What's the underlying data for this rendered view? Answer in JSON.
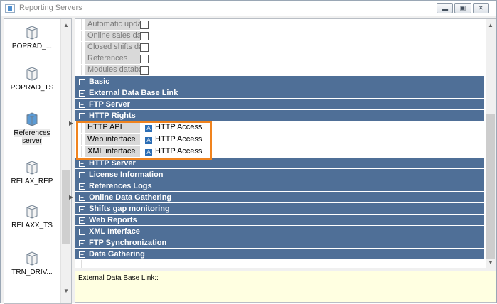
{
  "window": {
    "title": "Reporting Servers"
  },
  "servers": [
    {
      "name": "POPRAD_...",
      "selected": false
    },
    {
      "name": "POPRAD_TS",
      "selected": false
    },
    {
      "name": "References server",
      "selected": true
    },
    {
      "name": "RELAX_REP",
      "selected": false
    },
    {
      "name": "RELAXX_TS",
      "selected": false
    },
    {
      "name": "TRN_DRIV...",
      "selected": false
    }
  ],
  "properties": [
    "Automatic update",
    "Online sales data",
    "Closed shifts data",
    "References",
    "Modules database"
  ],
  "categories_top": [
    "Basic",
    "External Data Base Link",
    "FTP Server"
  ],
  "http_rights": {
    "label": "HTTP Rights",
    "items": [
      {
        "name": "HTTP API",
        "value": "HTTP Access"
      },
      {
        "name": "Web interface",
        "value": "HTTP Access"
      },
      {
        "name": "XML interface",
        "value": "HTTP Access"
      }
    ]
  },
  "categories_bottom": [
    "HTTP Server",
    "License Information",
    "References Logs",
    "Online Data Gathering",
    "Shifts gap monitoring",
    "Web Reports",
    "XML Interface",
    "FTP Synchronization",
    "Data Gathering"
  ],
  "description": "External Data Base Link::",
  "colors": {
    "category": "#4f6f97",
    "highlight": "#f0831e",
    "description_bg": "#ffffe1"
  }
}
